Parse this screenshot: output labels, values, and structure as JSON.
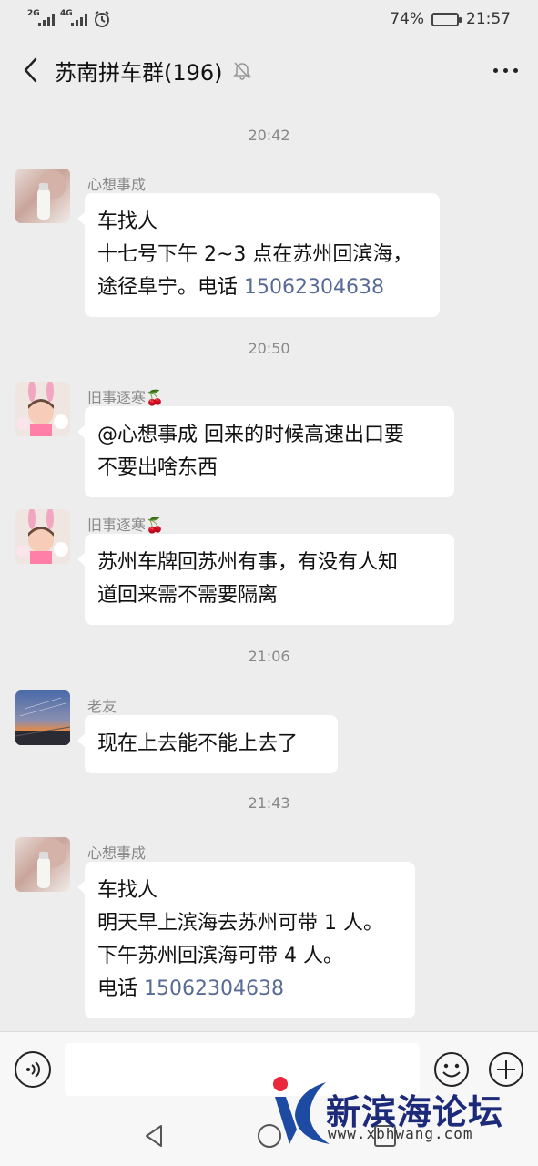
{
  "status_bar": {
    "signal1_tag": "2G",
    "signal2_tag": "4G",
    "battery_percent": "74%",
    "battery_level": 0.74,
    "time": "21:57"
  },
  "nav": {
    "title": "苏南拼车群(196)"
  },
  "messages": [
    {
      "time": "20:42",
      "sender": "心想事成",
      "lines": [
        "车找人",
        "十七号下午 2~3 点在苏州回滨海，"
      ],
      "last_prefix": "途径阜宁。电话 ",
      "phone": "15062304638"
    },
    {
      "time": "20:50",
      "sender": "旧事逐寒🍒",
      "lines": [
        "@心想事成  回来的时候高速出口要",
        "不要出啥东西"
      ]
    },
    {
      "sender": "旧事逐寒🍒",
      "lines": [
        "苏州车牌回苏州有事，有没有人知",
        "道回来需不需要隔离"
      ]
    },
    {
      "time": "21:06",
      "sender": "老友",
      "lines": [
        "现在上去能不能上去了"
      ]
    },
    {
      "time": "21:43",
      "sender": "心想事成",
      "lines": [
        "车找人",
        "明天早上滨海去苏州可带 1 人。",
        "下午苏州回滨海可带 4 人。"
      ],
      "last_prefix": "电话 ",
      "phone": "15062304638"
    }
  ],
  "input": {
    "placeholder": ""
  },
  "watermark": {
    "title": "新滨海论坛",
    "url": "www.xbhwang.com"
  },
  "colors": {
    "background": "#ededed",
    "bubble": "#ffffff",
    "phone_link": "#576b95",
    "watermark_red": "#e8283c",
    "watermark_blue": "#1d4ba3"
  }
}
